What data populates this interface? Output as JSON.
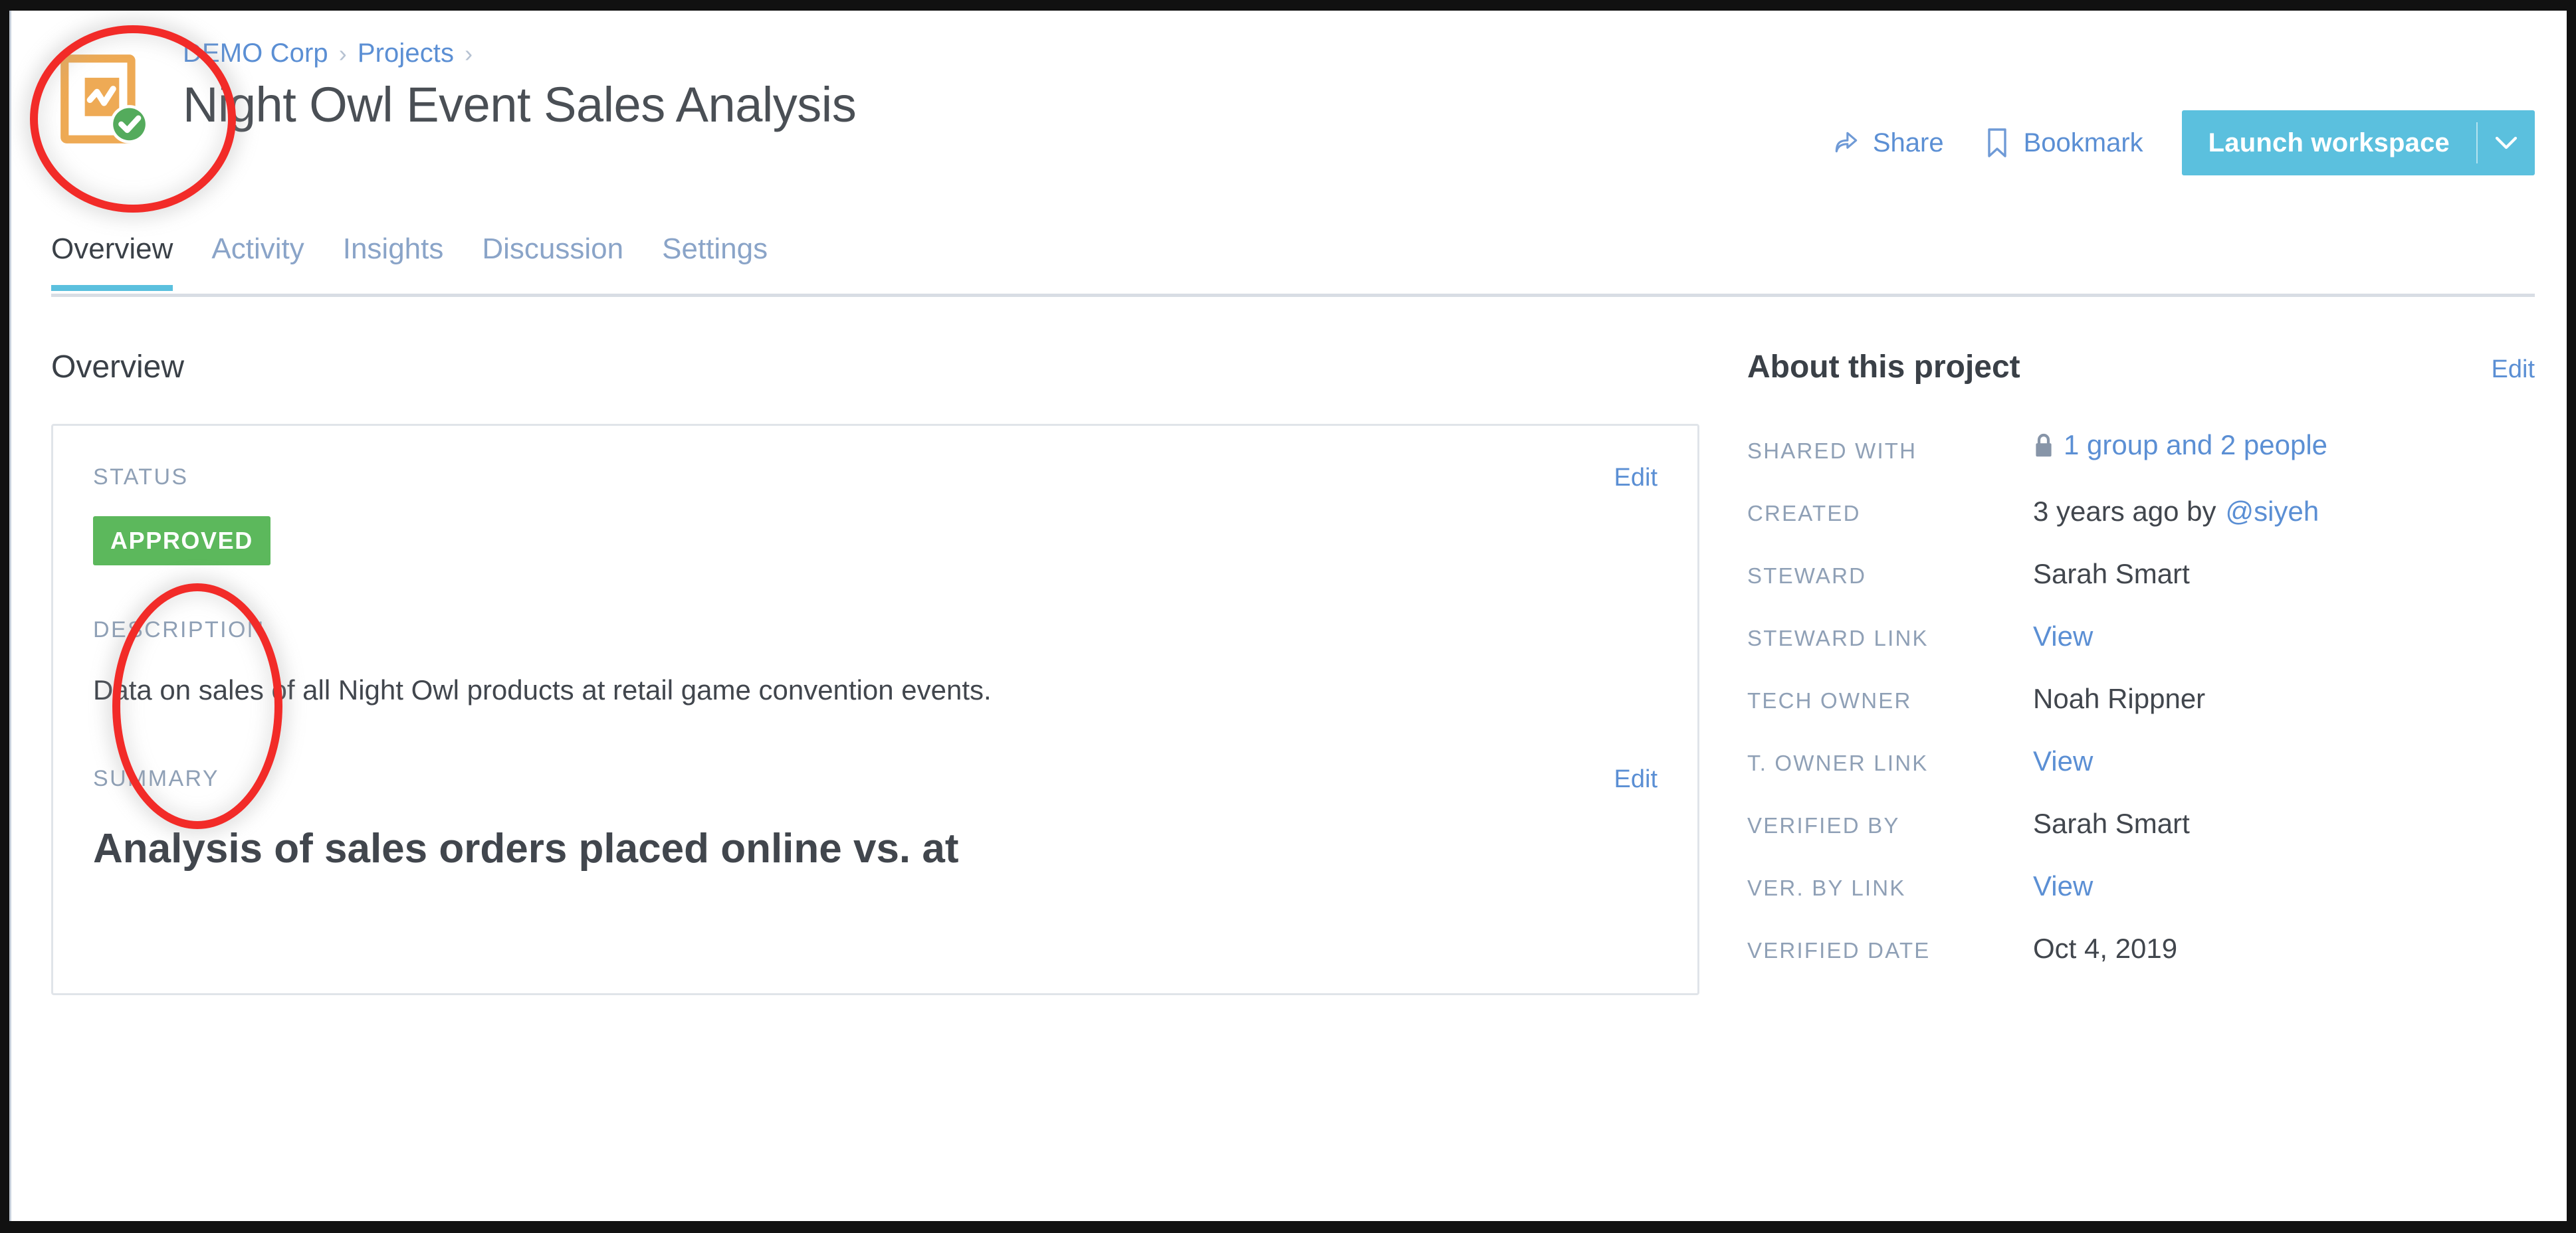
{
  "header": {
    "breadcrumb": [
      {
        "label": "DEMO Corp",
        "separator": "›"
      },
      {
        "label": "Projects",
        "separator": "›"
      }
    ],
    "title": "Night Owl Event Sales Analysis",
    "project_icon": "chart-document-approved-icon",
    "actions": {
      "share_label": "Share",
      "share_icon": "share-arrow-icon",
      "bookmark_label": "Bookmark",
      "bookmark_icon": "bookmark-icon",
      "launch_label": "Launch workspace",
      "launch_caret_icon": "chevron-down-icon"
    }
  },
  "tabs": [
    {
      "label": "Overview",
      "active": true
    },
    {
      "label": "Activity",
      "active": false
    },
    {
      "label": "Insights",
      "active": false
    },
    {
      "label": "Discussion",
      "active": false
    },
    {
      "label": "Settings",
      "active": false
    }
  ],
  "main": {
    "section_heading": "Overview",
    "status": {
      "label": "STATUS",
      "edit_label": "Edit",
      "badge": "APPROVED"
    },
    "description": {
      "label": "DESCRIPTION",
      "text": "Data on sales of all Night Owl products at retail game convention events."
    },
    "summary": {
      "label": "SUMMARY",
      "edit_label": "Edit",
      "heading": "Analysis of sales orders placed online vs. at"
    }
  },
  "side": {
    "title": "About this project",
    "edit_label": "Edit",
    "rows": [
      {
        "label": "SHARED WITH",
        "value": "1 group and 2 people",
        "type": "link",
        "icon": "lock-icon"
      },
      {
        "label": "CREATED",
        "value": "3 years ago by ",
        "type": "mixed",
        "link_text": "@siyeh"
      },
      {
        "label": "STEWARD",
        "value": "Sarah Smart",
        "type": "text"
      },
      {
        "label": "STEWARD LINK",
        "value": "View",
        "type": "link"
      },
      {
        "label": "TECH OWNER",
        "value": "Noah Rippner",
        "type": "text"
      },
      {
        "label": "T. OWNER LINK",
        "value": "View",
        "type": "link"
      },
      {
        "label": "VERIFIED BY",
        "value": "Sarah Smart",
        "type": "text"
      },
      {
        "label": "VER. BY LINK",
        "value": "View",
        "type": "link"
      },
      {
        "label": "VERIFIED DATE",
        "value": "Oct 4, 2019",
        "type": "text"
      }
    ]
  },
  "annotations": [
    {
      "name": "icon-highlight",
      "shape": "ellipse",
      "color": "#f22b28"
    },
    {
      "name": "status-highlight",
      "shape": "ellipse",
      "color": "#f22b28"
    }
  ],
  "colors": {
    "accent_blue": "#5bc0de",
    "link_blue": "#5b8fd4",
    "status_green": "#5cb85c",
    "icon_orange": "#eeaa55",
    "annotation_red": "#f22b28",
    "label_gray": "#8fa0b6",
    "text_dark": "#41464d"
  }
}
